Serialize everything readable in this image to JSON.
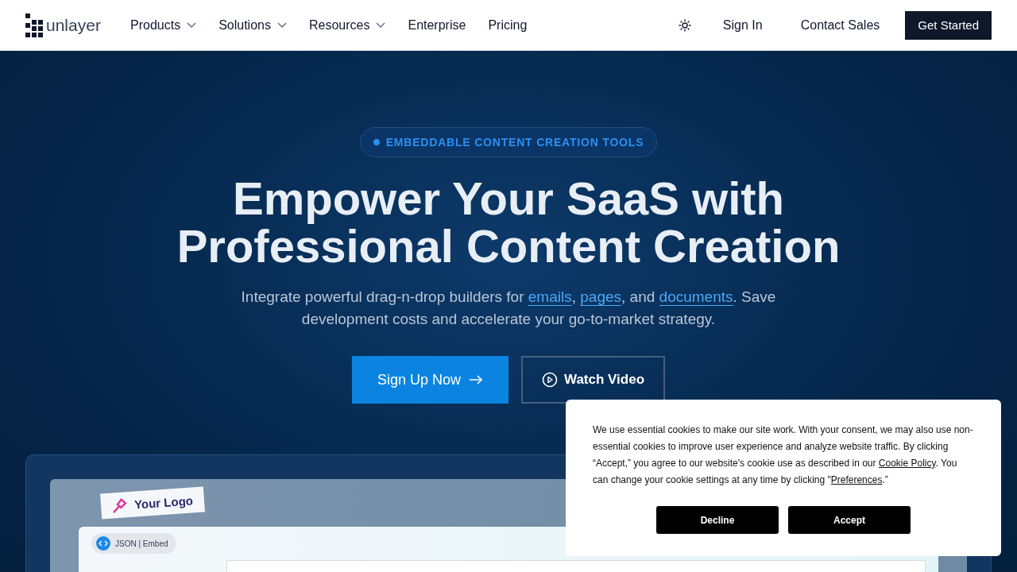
{
  "nav": {
    "logo": "unlayer",
    "items": [
      {
        "label": "Products",
        "dropdown": true
      },
      {
        "label": "Solutions",
        "dropdown": true
      },
      {
        "label": "Resources",
        "dropdown": true
      },
      {
        "label": "Enterprise",
        "dropdown": false
      },
      {
        "label": "Pricing",
        "dropdown": false
      }
    ],
    "sign_in": "Sign In",
    "contact": "Contact Sales",
    "cta": "Get Started"
  },
  "hero": {
    "badge": "EMBEDDABLE CONTENT CREATION TOOLS",
    "title": [
      "Empower Your SaaS with",
      "Professional Content Creation"
    ],
    "subtitle": [
      {
        "kind": "text",
        "text": "Integrate powerful drag-n-drop builders for "
      },
      {
        "kind": "link",
        "text": "emails"
      },
      {
        "kind": "text",
        "text": ", "
      },
      {
        "kind": "link",
        "text": "pages"
      },
      {
        "kind": "text",
        "text": ", and "
      },
      {
        "kind": "link",
        "text": "documents"
      },
      {
        "kind": "text",
        "text": ". Save development costs and accelerate your go-to-market strategy."
      }
    ],
    "primary": "Sign Up Now",
    "secondary": "Watch Video"
  },
  "editor": {
    "logo_tag": "Your Logo",
    "chip": "JSON | Embed"
  },
  "cookie": {
    "text": [
      {
        "kind": "text",
        "text": "We use essential cookies to make our site work. With your consent, we may also use non-essential cookies to improve user experience and analyze website traffic. By clicking “Accept,” you agree to our website's cookie use as described in our "
      },
      {
        "kind": "link",
        "text": "Cookie Policy"
      },
      {
        "kind": "text",
        "text": ". You can change your cookie settings at any time by clicking \""
      },
      {
        "kind": "link",
        "text": "Preferences"
      },
      {
        "kind": "text",
        "text": ".”"
      }
    ],
    "buttons": [
      "Decline",
      "Accept"
    ]
  }
}
